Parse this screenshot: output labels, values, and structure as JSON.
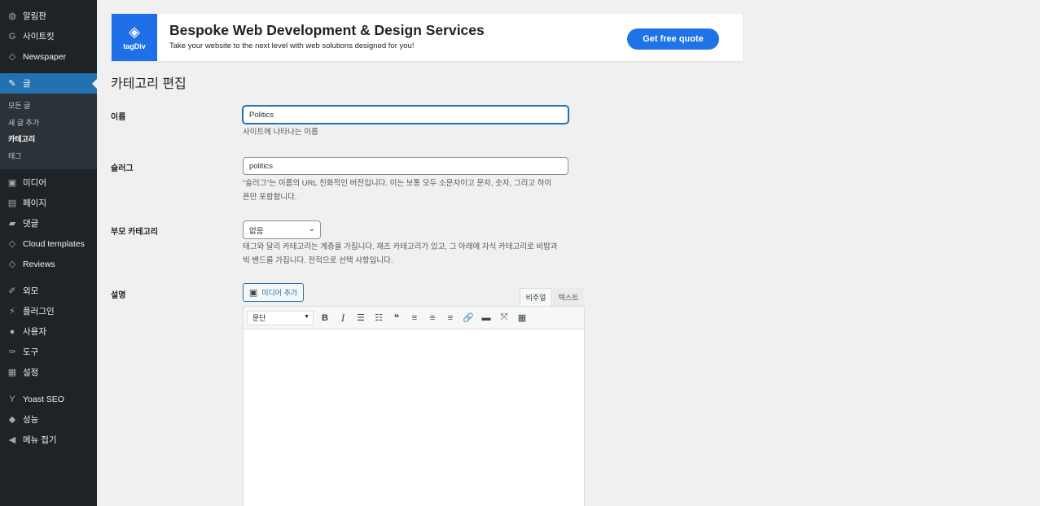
{
  "sidebar": {
    "items_top": [
      {
        "icon": "dashboard-icon",
        "glyph": "◍",
        "label": "알림판"
      },
      {
        "icon": "sitekit-icon",
        "glyph": "G",
        "label": "사이트킷"
      },
      {
        "icon": "newspaper-icon",
        "glyph": "◇",
        "label": "Newspaper"
      }
    ],
    "active": {
      "icon": "pin-icon",
      "glyph": "✎",
      "label": "글"
    },
    "submenu": [
      "모든 글",
      "새 글 추가",
      "카테고리",
      "태그"
    ],
    "submenu_current": "카테고리",
    "items_mid": [
      {
        "icon": "media-icon",
        "glyph": "▣",
        "label": "미디어"
      },
      {
        "icon": "pages-icon",
        "glyph": "▤",
        "label": "페이지"
      },
      {
        "icon": "comments-icon",
        "glyph": "▰",
        "label": "댓글"
      },
      {
        "icon": "cloud-templates-icon",
        "glyph": "◇",
        "label": "Cloud templates"
      },
      {
        "icon": "reviews-icon",
        "glyph": "◇",
        "label": "Reviews"
      }
    ],
    "items_bottom": [
      {
        "icon": "appearance-icon",
        "glyph": "✐",
        "label": "외모"
      },
      {
        "icon": "plugins-icon",
        "glyph": "⚡",
        "label": "플러그인"
      },
      {
        "icon": "users-icon",
        "glyph": "●",
        "label": "사용자"
      },
      {
        "icon": "tools-icon",
        "glyph": "✑",
        "label": "도구"
      },
      {
        "icon": "settings-icon",
        "glyph": "▦",
        "label": "설정"
      }
    ],
    "items_extra": [
      {
        "icon": "yoast-icon",
        "glyph": "Y",
        "label": "Yoast SEO"
      },
      {
        "icon": "performance-icon",
        "glyph": "◆",
        "label": "성능"
      },
      {
        "icon": "collapse-icon",
        "glyph": "◀",
        "label": "메뉴 접기"
      }
    ]
  },
  "banner": {
    "logo_mark": "◈",
    "logo_name": "tagDiv",
    "title": "Bespoke Web Development & Design Services",
    "subtitle": "Take your website to the next level with web solutions designed for you!",
    "button": "Get free quote",
    "accent": "#1e73e8"
  },
  "page": {
    "title": "카테고리 편집"
  },
  "form": {
    "name_label": "이름",
    "name_value": "Politics",
    "name_help": "사이트에 나타나는 이름",
    "slug_label": "슬러그",
    "slug_value": "politics",
    "slug_help_1": "“슬러그”는 이름의 URL 친화적인 버전입니다. 이는 보통 모두 소문자이고 문자, 숫자, 그리고 하이",
    "slug_help_2": "픈만 포함합니다.",
    "parent_label": "부모 카테고리",
    "parent_value": "없음",
    "parent_help_1": "태그와 달리 카테고리는 계층을 가집니다. 재즈 카테고리가 있고, 그 아래에 자식 카테고리로 비밥과",
    "parent_help_2": "빅 밴드를 가집니다. 전적으로 선택 사항입니다.",
    "description_label": "설명"
  },
  "editor": {
    "media_button": "미디어 추가",
    "tab_visual": "비주얼",
    "tab_text": "텍스트",
    "format": "문단",
    "tools": [
      {
        "name": "bold-button",
        "glyph": "B",
        "cls": "bold"
      },
      {
        "name": "italic-button",
        "glyph": "I",
        "cls": "italic"
      },
      {
        "name": "bullet-list-button",
        "glyph": "☰",
        "cls": ""
      },
      {
        "name": "numbered-list-button",
        "glyph": "☷",
        "cls": ""
      },
      {
        "name": "blockquote-button",
        "glyph": "❝",
        "cls": "bold"
      },
      {
        "name": "align-left-button",
        "glyph": "≡",
        "cls": ""
      },
      {
        "name": "align-center-button",
        "glyph": "≡",
        "cls": ""
      },
      {
        "name": "align-right-button",
        "glyph": "≡",
        "cls": ""
      },
      {
        "name": "link-button",
        "glyph": "🔗",
        "cls": ""
      },
      {
        "name": "read-more-button",
        "glyph": "▬",
        "cls": ""
      },
      {
        "name": "fullscreen-button",
        "glyph": "⤧",
        "cls": ""
      },
      {
        "name": "toolbar-toggle-button",
        "glyph": "▦",
        "cls": ""
      }
    ]
  }
}
